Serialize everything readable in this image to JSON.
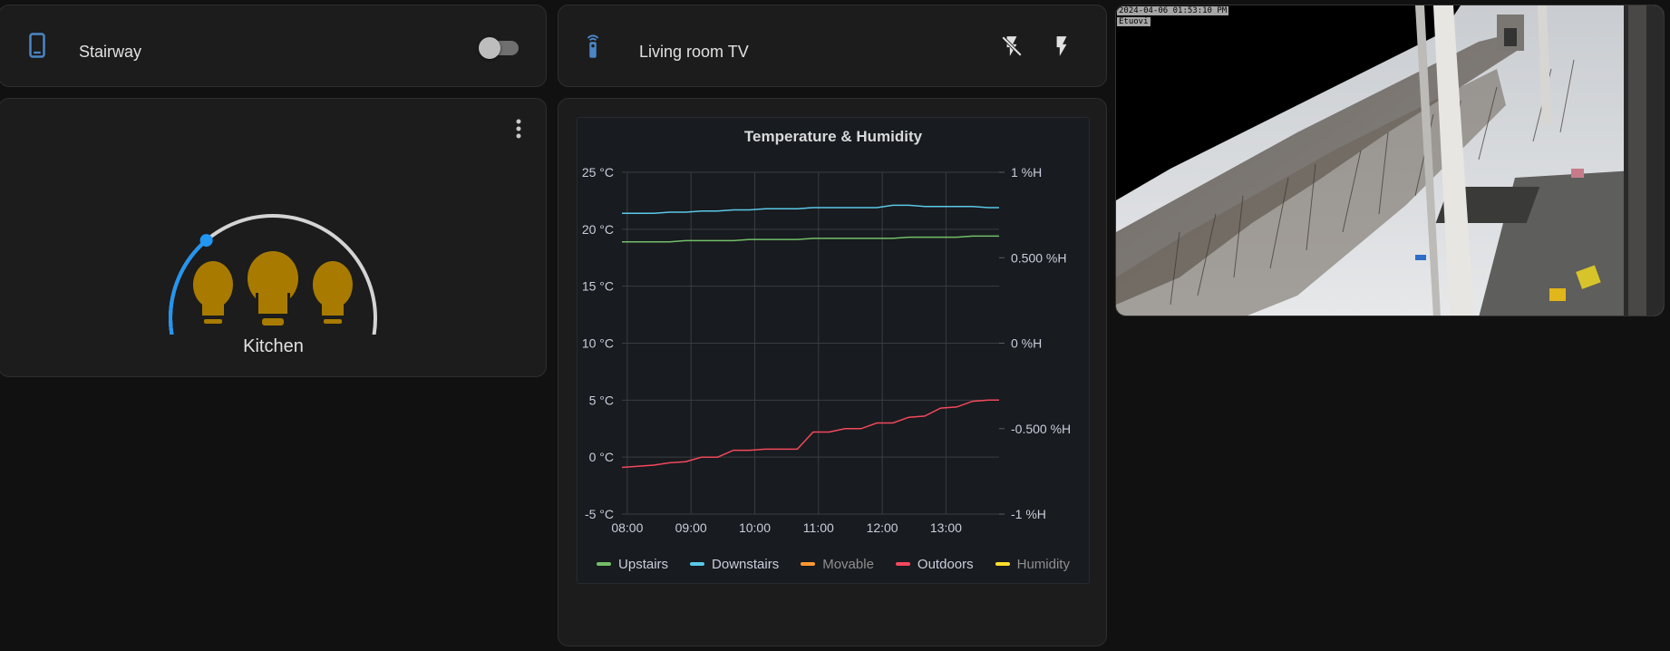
{
  "stairway": {
    "name": "Stairway",
    "icon": "cellphone-icon",
    "state": "off"
  },
  "tv": {
    "name": "Living room TV",
    "icon": "remote-icon",
    "actions": [
      "flash-off-icon",
      "flash-icon"
    ]
  },
  "kitchen": {
    "name": "Kitchen",
    "icon": "lightbulb-group-icon",
    "brightness_pct": 35,
    "icon_color": "#a87b00",
    "arc_color": "#2196f3"
  },
  "chart": {
    "title": "Temperature & Humidity"
  },
  "chart_data": {
    "type": "line",
    "title": "Temperature & Humidity",
    "x": [
      "07:55",
      "08:10",
      "08:25",
      "08:40",
      "08:55",
      "09:10",
      "09:25",
      "09:40",
      "09:55",
      "10:10",
      "10:25",
      "10:40",
      "10:55",
      "11:10",
      "11:25",
      "11:40",
      "11:55",
      "12:10",
      "12:25",
      "12:40",
      "12:55",
      "13:10",
      "13:25",
      "13:40",
      "13:50"
    ],
    "xticks": [
      "08:00",
      "09:00",
      "10:00",
      "11:00",
      "12:00",
      "13:00"
    ],
    "yleft_ticks": [
      "25 °C",
      "20 °C",
      "15 °C",
      "10 °C",
      "5 °C",
      "0 °C",
      "-5 °C"
    ],
    "yright_ticks": [
      "1 %H",
      "0.500 %H",
      "0 %H",
      "-0.500 %H",
      "-1 %H"
    ],
    "ylim_left": [
      -5,
      25
    ],
    "ylim_right": [
      -1,
      1
    ],
    "grid": true,
    "legend_position": "bottom",
    "series": [
      {
        "name": "Upstairs",
        "color": "#73bf69",
        "axis": "left",
        "values": [
          18.9,
          18.9,
          18.9,
          18.9,
          19.0,
          19.0,
          19.0,
          19.0,
          19.1,
          19.1,
          19.1,
          19.1,
          19.2,
          19.2,
          19.2,
          19.2,
          19.2,
          19.2,
          19.3,
          19.3,
          19.3,
          19.3,
          19.4,
          19.4,
          19.4
        ]
      },
      {
        "name": "Downstairs",
        "color": "#5bc8e8",
        "axis": "left",
        "values": [
          21.4,
          21.4,
          21.4,
          21.5,
          21.5,
          21.6,
          21.6,
          21.7,
          21.7,
          21.8,
          21.8,
          21.8,
          21.9,
          21.9,
          21.9,
          21.9,
          21.9,
          22.1,
          22.1,
          22.0,
          22.0,
          22.0,
          22.0,
          21.9,
          21.9
        ]
      },
      {
        "name": "Movable",
        "color": "#ff9830",
        "axis": "left",
        "values": [],
        "hidden": true
      },
      {
        "name": "Outdoors",
        "color": "#f2495c",
        "axis": "left",
        "values": [
          -0.9,
          -0.8,
          -0.7,
          -0.5,
          -0.4,
          0.0,
          0.0,
          0.6,
          0.6,
          0.7,
          0.7,
          0.7,
          2.2,
          2.2,
          2.5,
          2.5,
          3.0,
          3.0,
          3.5,
          3.6,
          4.3,
          4.4,
          4.9,
          5.0,
          5.0
        ]
      },
      {
        "name": "Humidity",
        "color": "#fade2a",
        "axis": "right",
        "values": [],
        "hidden": true
      }
    ]
  },
  "camera": {
    "timestamp": "2024-04-06 01:53:10 PM",
    "label": "Etuovi"
  }
}
